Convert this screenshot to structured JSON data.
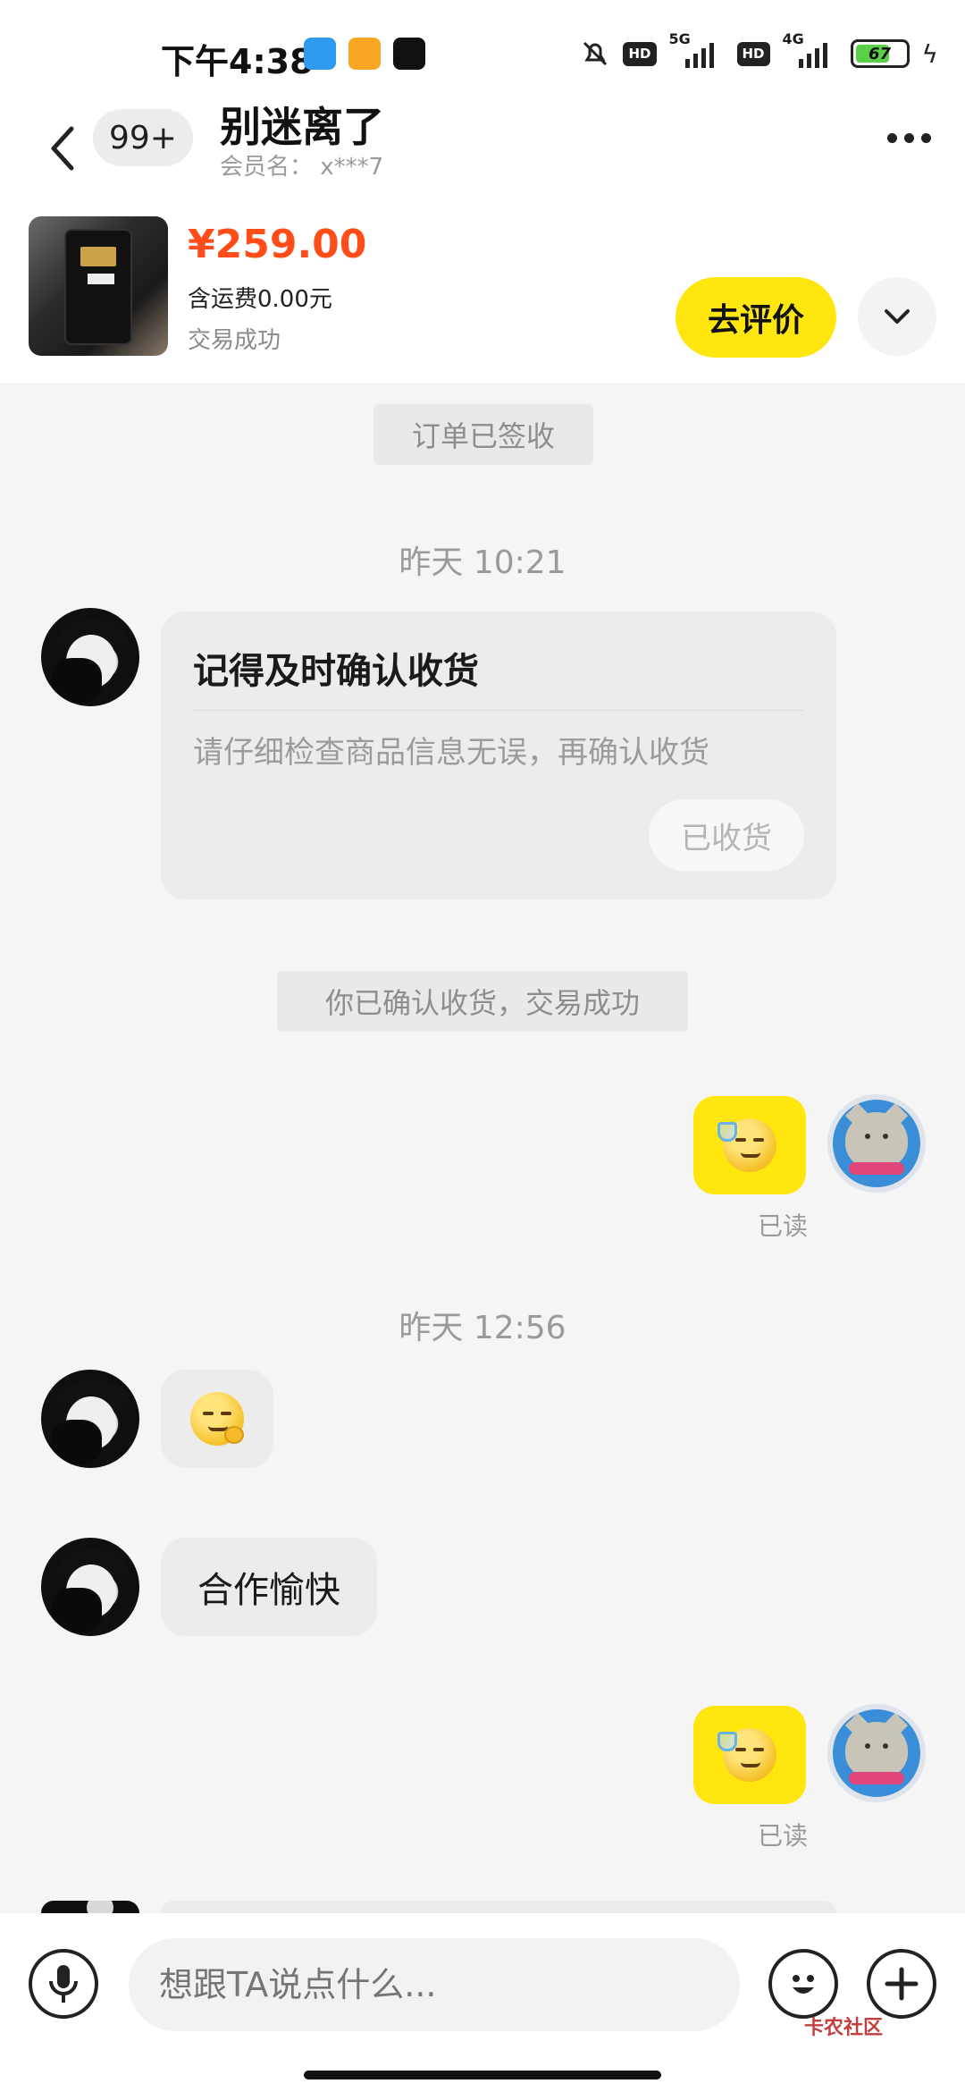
{
  "status_bar": {
    "time": "下午4:38",
    "network_1": "5G",
    "network_2": "4G",
    "hd_label": "HD",
    "battery": "67"
  },
  "header": {
    "unread_count": "99+",
    "title": "别迷离了",
    "member_name": "会员名： x***7"
  },
  "product": {
    "price": "¥259.00",
    "shipping": "含运费0.00元",
    "status": "交易成功",
    "review_button": "去评价"
  },
  "messages": {
    "sys_signed": "订单已签收",
    "time_1": "昨天 10:21",
    "card_title": "记得及时确认收货",
    "card_body": "请仔细检查商品信息无误，再确认收货",
    "card_button": "已收货",
    "sys_confirmed": "你已确认收货，交易成功",
    "read_1": "已读",
    "time_2": "昨天 12:56",
    "text_msg": "合作愉快",
    "read_2": "已读"
  },
  "input": {
    "placeholder": "想跟TA说点什么..."
  },
  "watermark": "卡农社区",
  "colors": {
    "accent_yellow": "#ffe60f",
    "price_orange": "#ff4d1a",
    "bubble_gray": "#ececec"
  },
  "icons": [
    "back-arrow-icon",
    "more-icon",
    "chevron-down-icon",
    "mic-icon",
    "emoji-icon",
    "plus-icon",
    "sunglasses-drink-emoji",
    "smile-ok-emoji"
  ]
}
